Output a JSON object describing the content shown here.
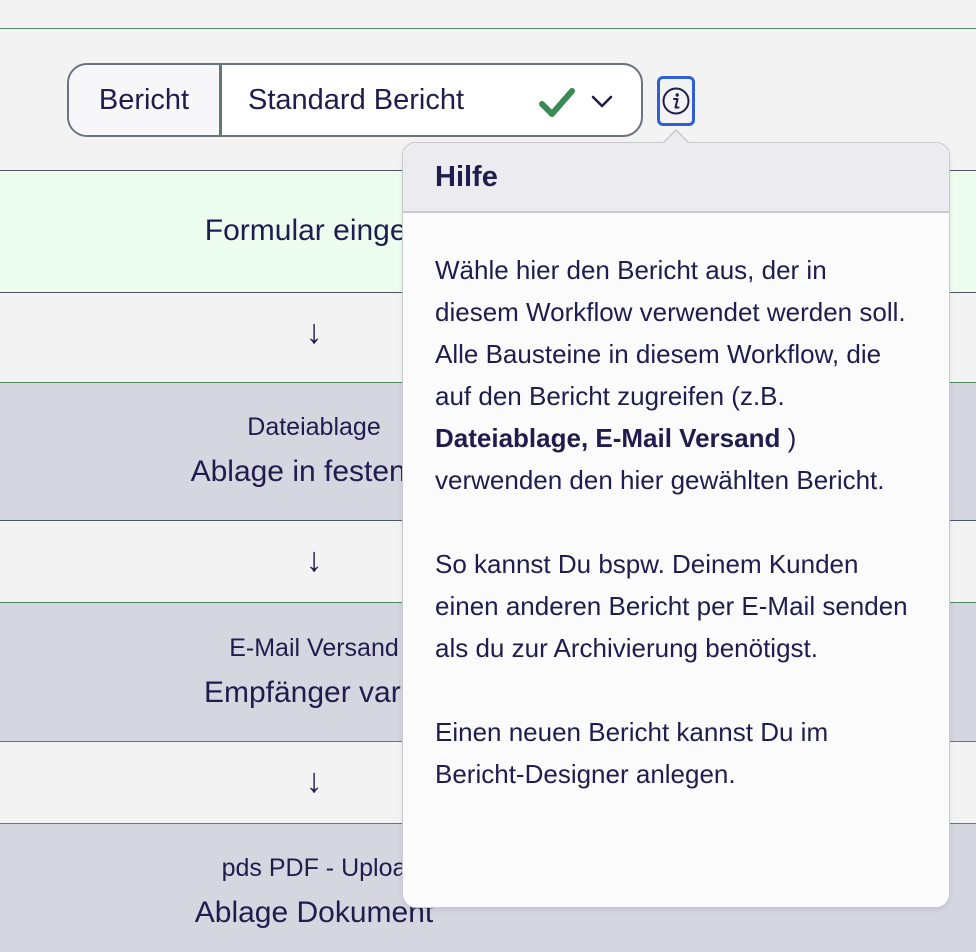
{
  "report_select": {
    "label": "Bericht",
    "value": "Standard Bericht",
    "status_icon": "check-icon",
    "expand_icon": "chevron-down-icon",
    "colors": {
      "check": "#3a8a55"
    }
  },
  "info_button": {
    "icon": "info-icon",
    "border_color": "#2e5fd6"
  },
  "workflow": {
    "trigger": {
      "label": "Formular eingeg"
    },
    "arrow": "↓",
    "steps": [
      {
        "type": "Dateiablage",
        "label": "Ablage in festen O"
      },
      {
        "type": "E-Mail Versand",
        "label": "Empfänger varia"
      },
      {
        "type": "pds PDF - Uploa",
        "label": "Ablage Dokument"
      }
    ]
  },
  "help_popover": {
    "title": "Hilfe",
    "para1_start": "Wähle hier den Bericht aus, der in diesem Workflow verwendet werden soll. Alle Bausteine in diesem Workflow, die auf den Bericht zugreifen (z.B. ",
    "para1_bold": "Dateiablage, E-Mail Versand",
    "para1_end": " ) verwenden den hier gewählten Bericht.",
    "para2": "So kannst Du bspw. Deinem Kunden einen anderen Bericht per E-Mail senden als du zur Archivierung benötigst.",
    "para3": "Einen neuen Bericht kannst Du im Bericht-Designer anlegen."
  }
}
